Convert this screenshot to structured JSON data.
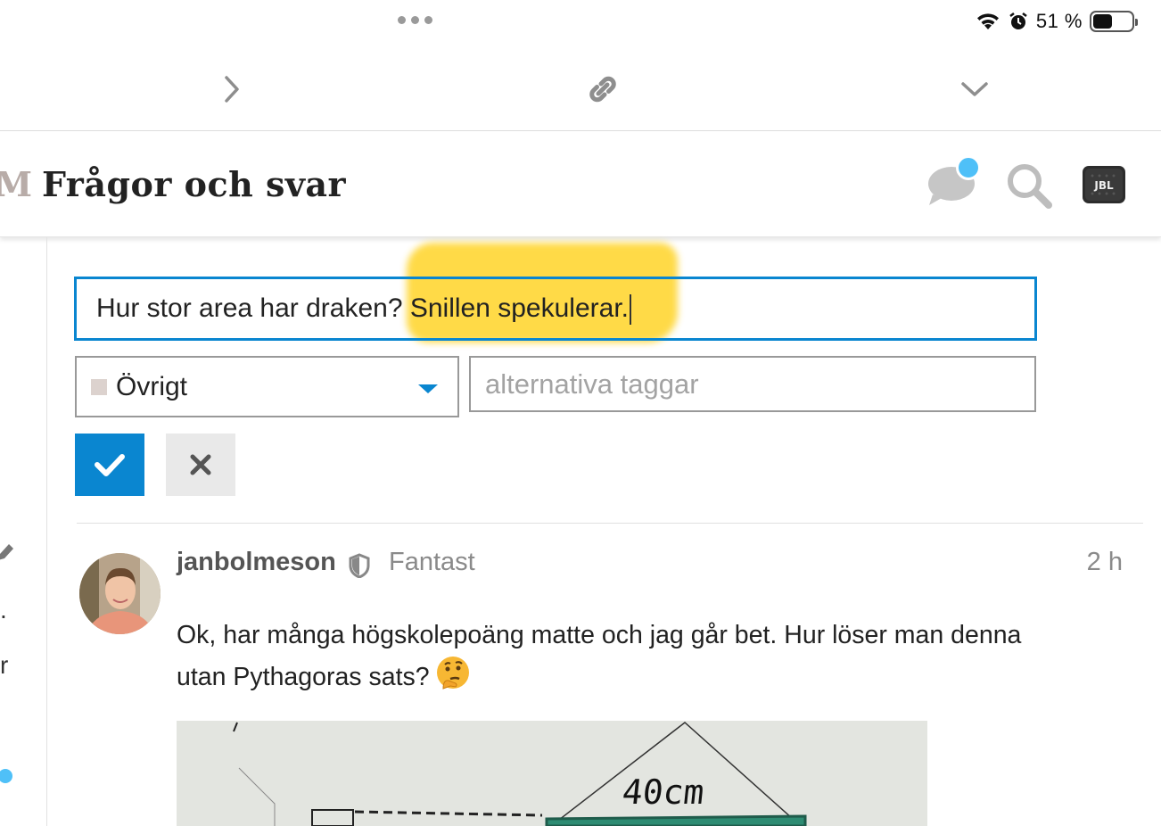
{
  "status_bar": {
    "battery_percent": "51 %",
    "battery_level": 0.51,
    "icons": [
      "wifi-icon",
      "alarm-icon",
      "battery-icon"
    ]
  },
  "toolbar": {
    "icons": [
      "chevron-right-icon",
      "link-icon",
      "chevron-down-icon"
    ]
  },
  "header": {
    "logo_fragment": "M",
    "title": "Frågor och svar",
    "icons": [
      "chat-icon",
      "search-icon",
      "avatar-jbl"
    ],
    "notification_color": "#4fc0f8"
  },
  "edit_form": {
    "title_value": "Hur stor area har draken? Snillen spekulerar.",
    "category": {
      "selected": "Övrigt",
      "swatch_color": "#dcd2ce"
    },
    "tags_placeholder": "alternativa taggar",
    "accent_color": "#0a86d0"
  },
  "left_column": {
    "chars": [
      ".",
      "r"
    ]
  },
  "post": {
    "username": "janbolmeson",
    "user_title": "Fantast",
    "time": "2 h",
    "body_line1": "Ok, har många högskolepoäng matte och jag går bet. Hur löser man denna",
    "body_line2": "utan Pythagoras sats?",
    "emoji": "thinking-face",
    "image_label": "40cm"
  }
}
